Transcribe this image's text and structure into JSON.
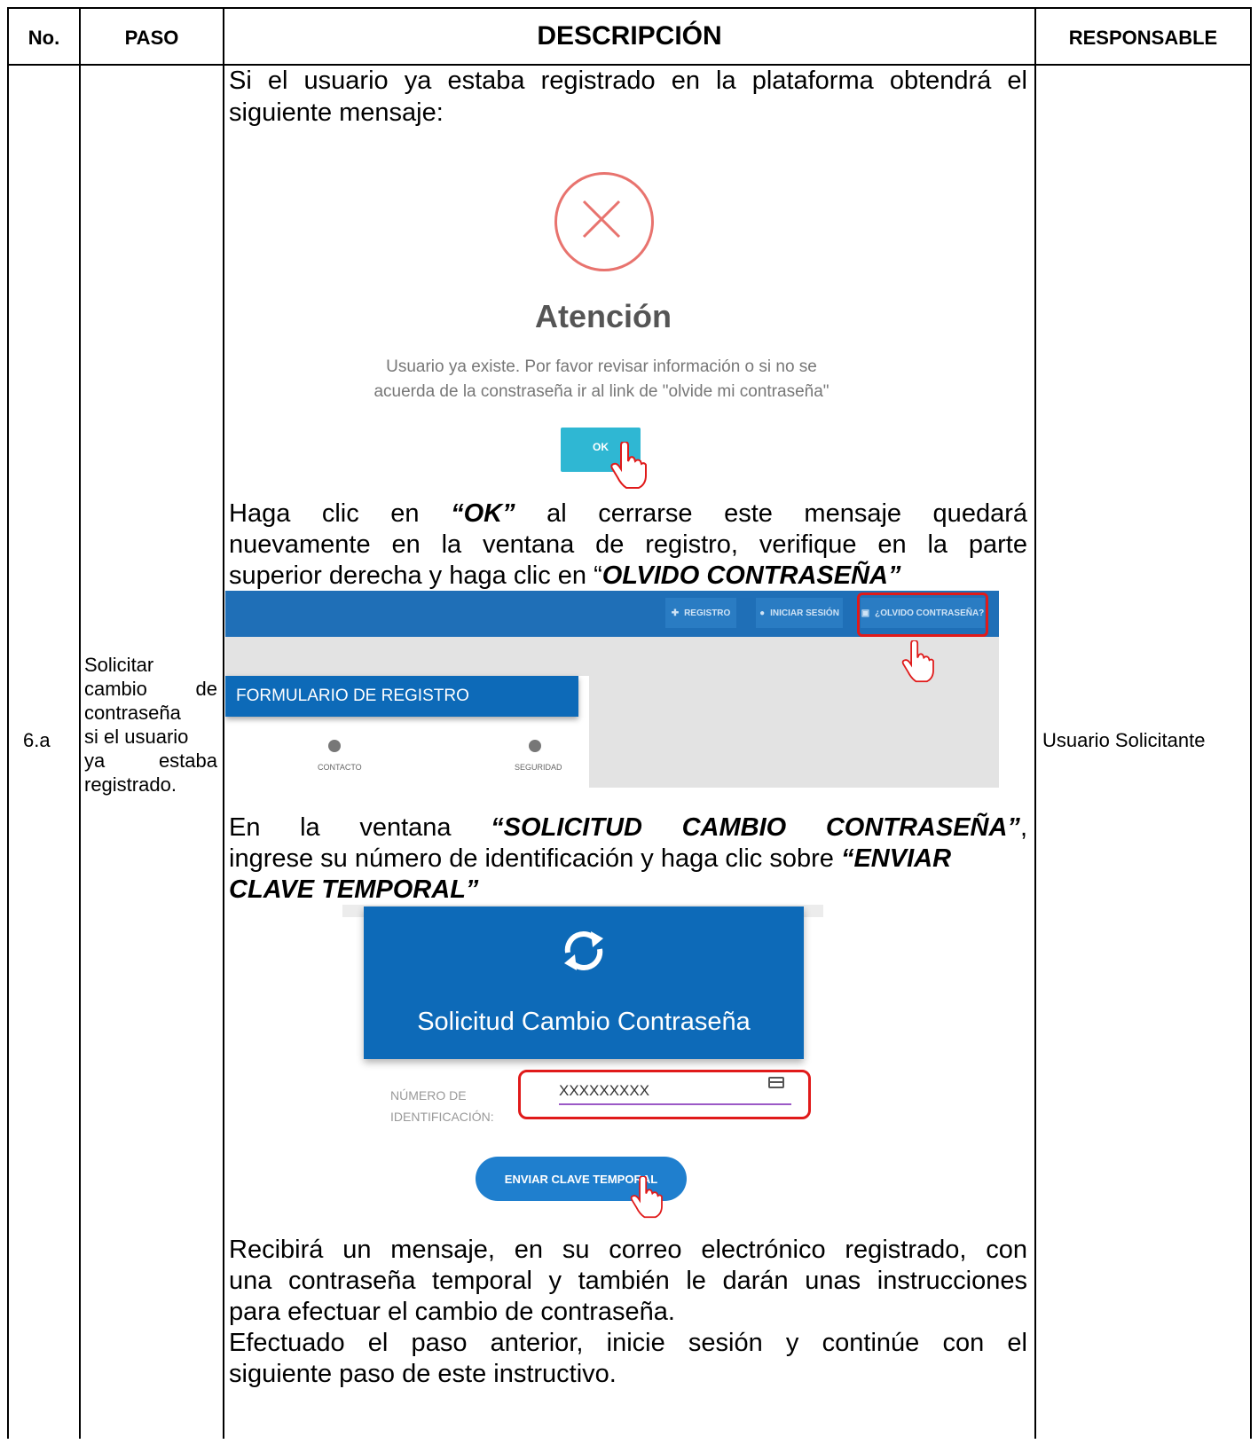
{
  "table": {
    "headers": {
      "no": "No.",
      "paso": "PASO",
      "descripcion": "DESCRIPCIÓN",
      "responsable": "RESPONSABLE"
    },
    "row": {
      "no": "6.a",
      "paso_lines": [
        "Solicitar",
        "cambio de",
        "contraseña",
        "si el usuario",
        "ya estaba",
        "registrado."
      ],
      "responsable": "Usuario Solicitante"
    }
  },
  "description": {
    "p1_line1": "Si el usuario ya estaba registrado en la plataforma obtendrá el",
    "p1_line2": "siguiente mensaje:",
    "p2_line1_pre": "Haga clic en ",
    "p2_line1_bold": "“OK”",
    "p2_line1_post": " al cerrarse este mensaje quedará",
    "p2_line2": "nuevamente en la ventana de registro, verifique en la parte",
    "p2_line3_pre": "superior derecha y haga clic en “",
    "p2_line3_bold": "OLVIDO CONTRASEÑA”",
    "p3_line1_pre": "En la ventana ",
    "p3_line1_bold": "“SOLICITUD CAMBIO CONTRASEÑA”",
    "p3_line1_post": ",",
    "p3_line2_pre": "ingrese su número de identificación y haga clic sobre ",
    "p3_line2_bold": "“ENVIAR",
    "p3_line3_bold": "CLAVE TEMPORAL”",
    "p4_line1": "Recibirá un mensaje, en su correo electrónico registrado, con",
    "p4_line2": "una contraseña temporal y también le darán unas instrucciones",
    "p4_line3": "para efectuar el cambio de contraseña.",
    "p5_line1": "Efectuado el paso anterior, inicie sesión y continúe con el",
    "p5_line2": "siguiente paso de este instructivo."
  },
  "dialog": {
    "icon": "error-x-icon",
    "title": "Atención",
    "message_line1": "Usuario ya existe. Por favor revisar información o si no se",
    "message_line2": "acuerda de la constraseña ir al link de \"olvide mi contraseña\"",
    "ok_label": "OK",
    "accent_color": "#e8736e"
  },
  "navbar": {
    "buttons": [
      {
        "icon": "add-user-icon",
        "label": "REGISTRO"
      },
      {
        "icon": "login-icon",
        "label": "INICIAR SESIÓN"
      },
      {
        "icon": "lock-icon",
        "label": "¿OLVIDO CONTRASEÑA?"
      }
    ],
    "form_title": "FORMULARIO DE REGISTRO",
    "steps": [
      "CONTACTO",
      "SEGURIDAD"
    ],
    "color": "#1f6fb7"
  },
  "solicitud": {
    "icon": "refresh-icon",
    "title": "Solicitud Cambio Contraseña",
    "id_label_line1": "NÚMERO DE",
    "id_label_line2": "IDENTIFICACIÓN:",
    "id_value": "XXXXXXXXX",
    "send_label": "ENVIAR CLAVE TEMPORAL",
    "color": "#0d6ab8"
  }
}
